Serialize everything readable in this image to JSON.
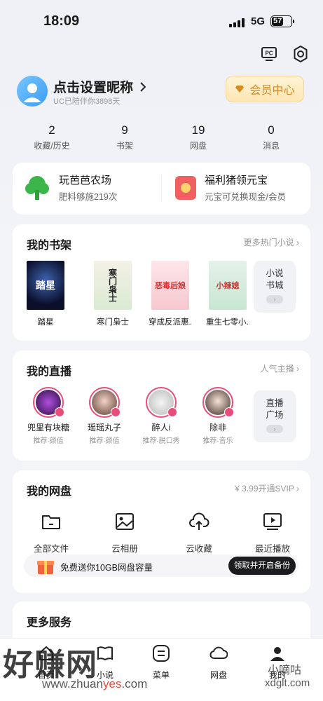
{
  "status_bar": {
    "time": "18:09",
    "network": "5G",
    "battery": "57"
  },
  "profile": {
    "nickname": "点击设置昵称",
    "since": "UC已陪伴你3898天",
    "vip_label": "会员中心"
  },
  "stats": [
    {
      "value": "2",
      "label": "收藏/历史"
    },
    {
      "value": "9",
      "label": "书架"
    },
    {
      "value": "19",
      "label": "网盘"
    },
    {
      "value": "0",
      "label": "消息"
    }
  ],
  "promos": [
    {
      "title": "玩芭芭农场",
      "subtitle": "肥料够施219次"
    },
    {
      "title": "福利猪领元宝",
      "subtitle": "元宝可兑换现金/会员"
    }
  ],
  "bookshelf": {
    "title": "我的书架",
    "more": "更多热门小说",
    "books": [
      {
        "name": "踏星",
        "cover_text": "踏星"
      },
      {
        "name": "寒门枭士",
        "cover_text": "寒门枭士"
      },
      {
        "name": "穿成反派惠...",
        "cover_text": "恶毒后娘"
      },
      {
        "name": "重生七零小...",
        "cover_text": "小辣媳"
      }
    ],
    "side_line1": "小说",
    "side_line2": "书城"
  },
  "live": {
    "title": "我的直播",
    "more": "人气主播",
    "streamers": [
      {
        "name": "兜里有块糖",
        "tag": "推荐·颜值"
      },
      {
        "name": "瑶瑶丸子",
        "tag": "推荐·颜值"
      },
      {
        "name": "醉人i",
        "tag": "推荐·脱口秀"
      },
      {
        "name": "除非",
        "tag": "推荐·音乐"
      }
    ],
    "side_line1": "直播",
    "side_line2": "广场"
  },
  "disk": {
    "title": "我的网盘",
    "more": "¥ 3.99开通SVIP",
    "items": [
      {
        "label": "全部文件",
        "icon": "folder-icon"
      },
      {
        "label": "云相册",
        "icon": "photo-icon"
      },
      {
        "label": "云收藏",
        "icon": "cloud-upload-icon"
      },
      {
        "label": "最近播放",
        "icon": "play-screen-icon"
      }
    ],
    "banner_text": "免费送你10GB网盘容量",
    "banner_button": "领取并开启备份"
  },
  "more_services": {
    "title": "更多服务"
  },
  "tabbar": [
    {
      "label": "首页"
    },
    {
      "label": "小说"
    },
    {
      "label": "菜单"
    },
    {
      "label": "网盘"
    },
    {
      "label": "我的"
    }
  ],
  "watermarks": {
    "left_big": "好赚网",
    "left_url_a": "www.zhuan",
    "left_url_b": "yes",
    "left_url_c": ".com",
    "right_url": "xdglt.com",
    "right_text": "小嘀咕"
  },
  "colors": {
    "accent_pink": "#e84d7a",
    "vip_gold": "#d98a1e",
    "promo_red": "#f06060",
    "farm_green": "#3cb54a"
  }
}
